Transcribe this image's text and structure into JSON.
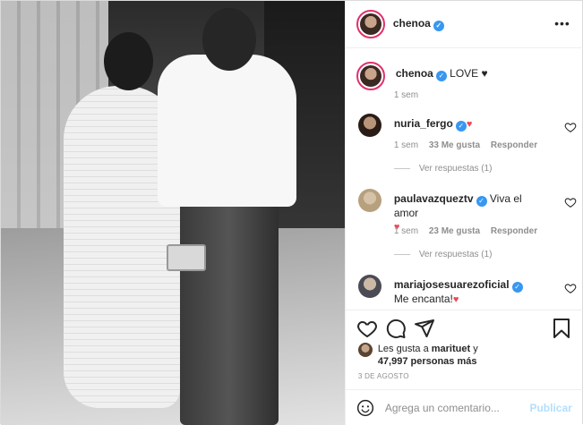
{
  "post": {
    "author": "chenoa",
    "verified_icon": "verified-badge-icon",
    "more_icon": "more-options-icon"
  },
  "caption": {
    "username": "chenoa",
    "text": "LOVE",
    "emoji": "♥",
    "time": "1 sem"
  },
  "comments": [
    {
      "username": "nuria_fergo",
      "text": "",
      "emoji": "♥",
      "time": "1 sem",
      "likes": "33 Me gusta",
      "reply_label": "Responder",
      "view_replies": "Ver respuestas (1)"
    },
    {
      "username": "paulavazqueztv",
      "text": "Viva el amor",
      "emoji": "♥",
      "time": "1 sem",
      "likes": "23 Me gusta",
      "reply_label": "Responder",
      "view_replies": "Ver respuestas (1)"
    },
    {
      "username": "mariajosesuarezoficial",
      "text": "Me encanta!",
      "emoji": "♥"
    }
  ],
  "likes": {
    "prefix": "Les gusta a",
    "user": "marituet",
    "conjunction": "y",
    "count": "47,997 personas más"
  },
  "date": "3 DE AGOSTO",
  "add_comment": {
    "placeholder": "Agrega un comentario...",
    "publish_label": "Publicar"
  },
  "colors": {
    "verified": "#3897f0",
    "heart_red": "#ed4956",
    "publish_disabled": "#b2dffc",
    "muted_text": "#8e8e8e"
  }
}
